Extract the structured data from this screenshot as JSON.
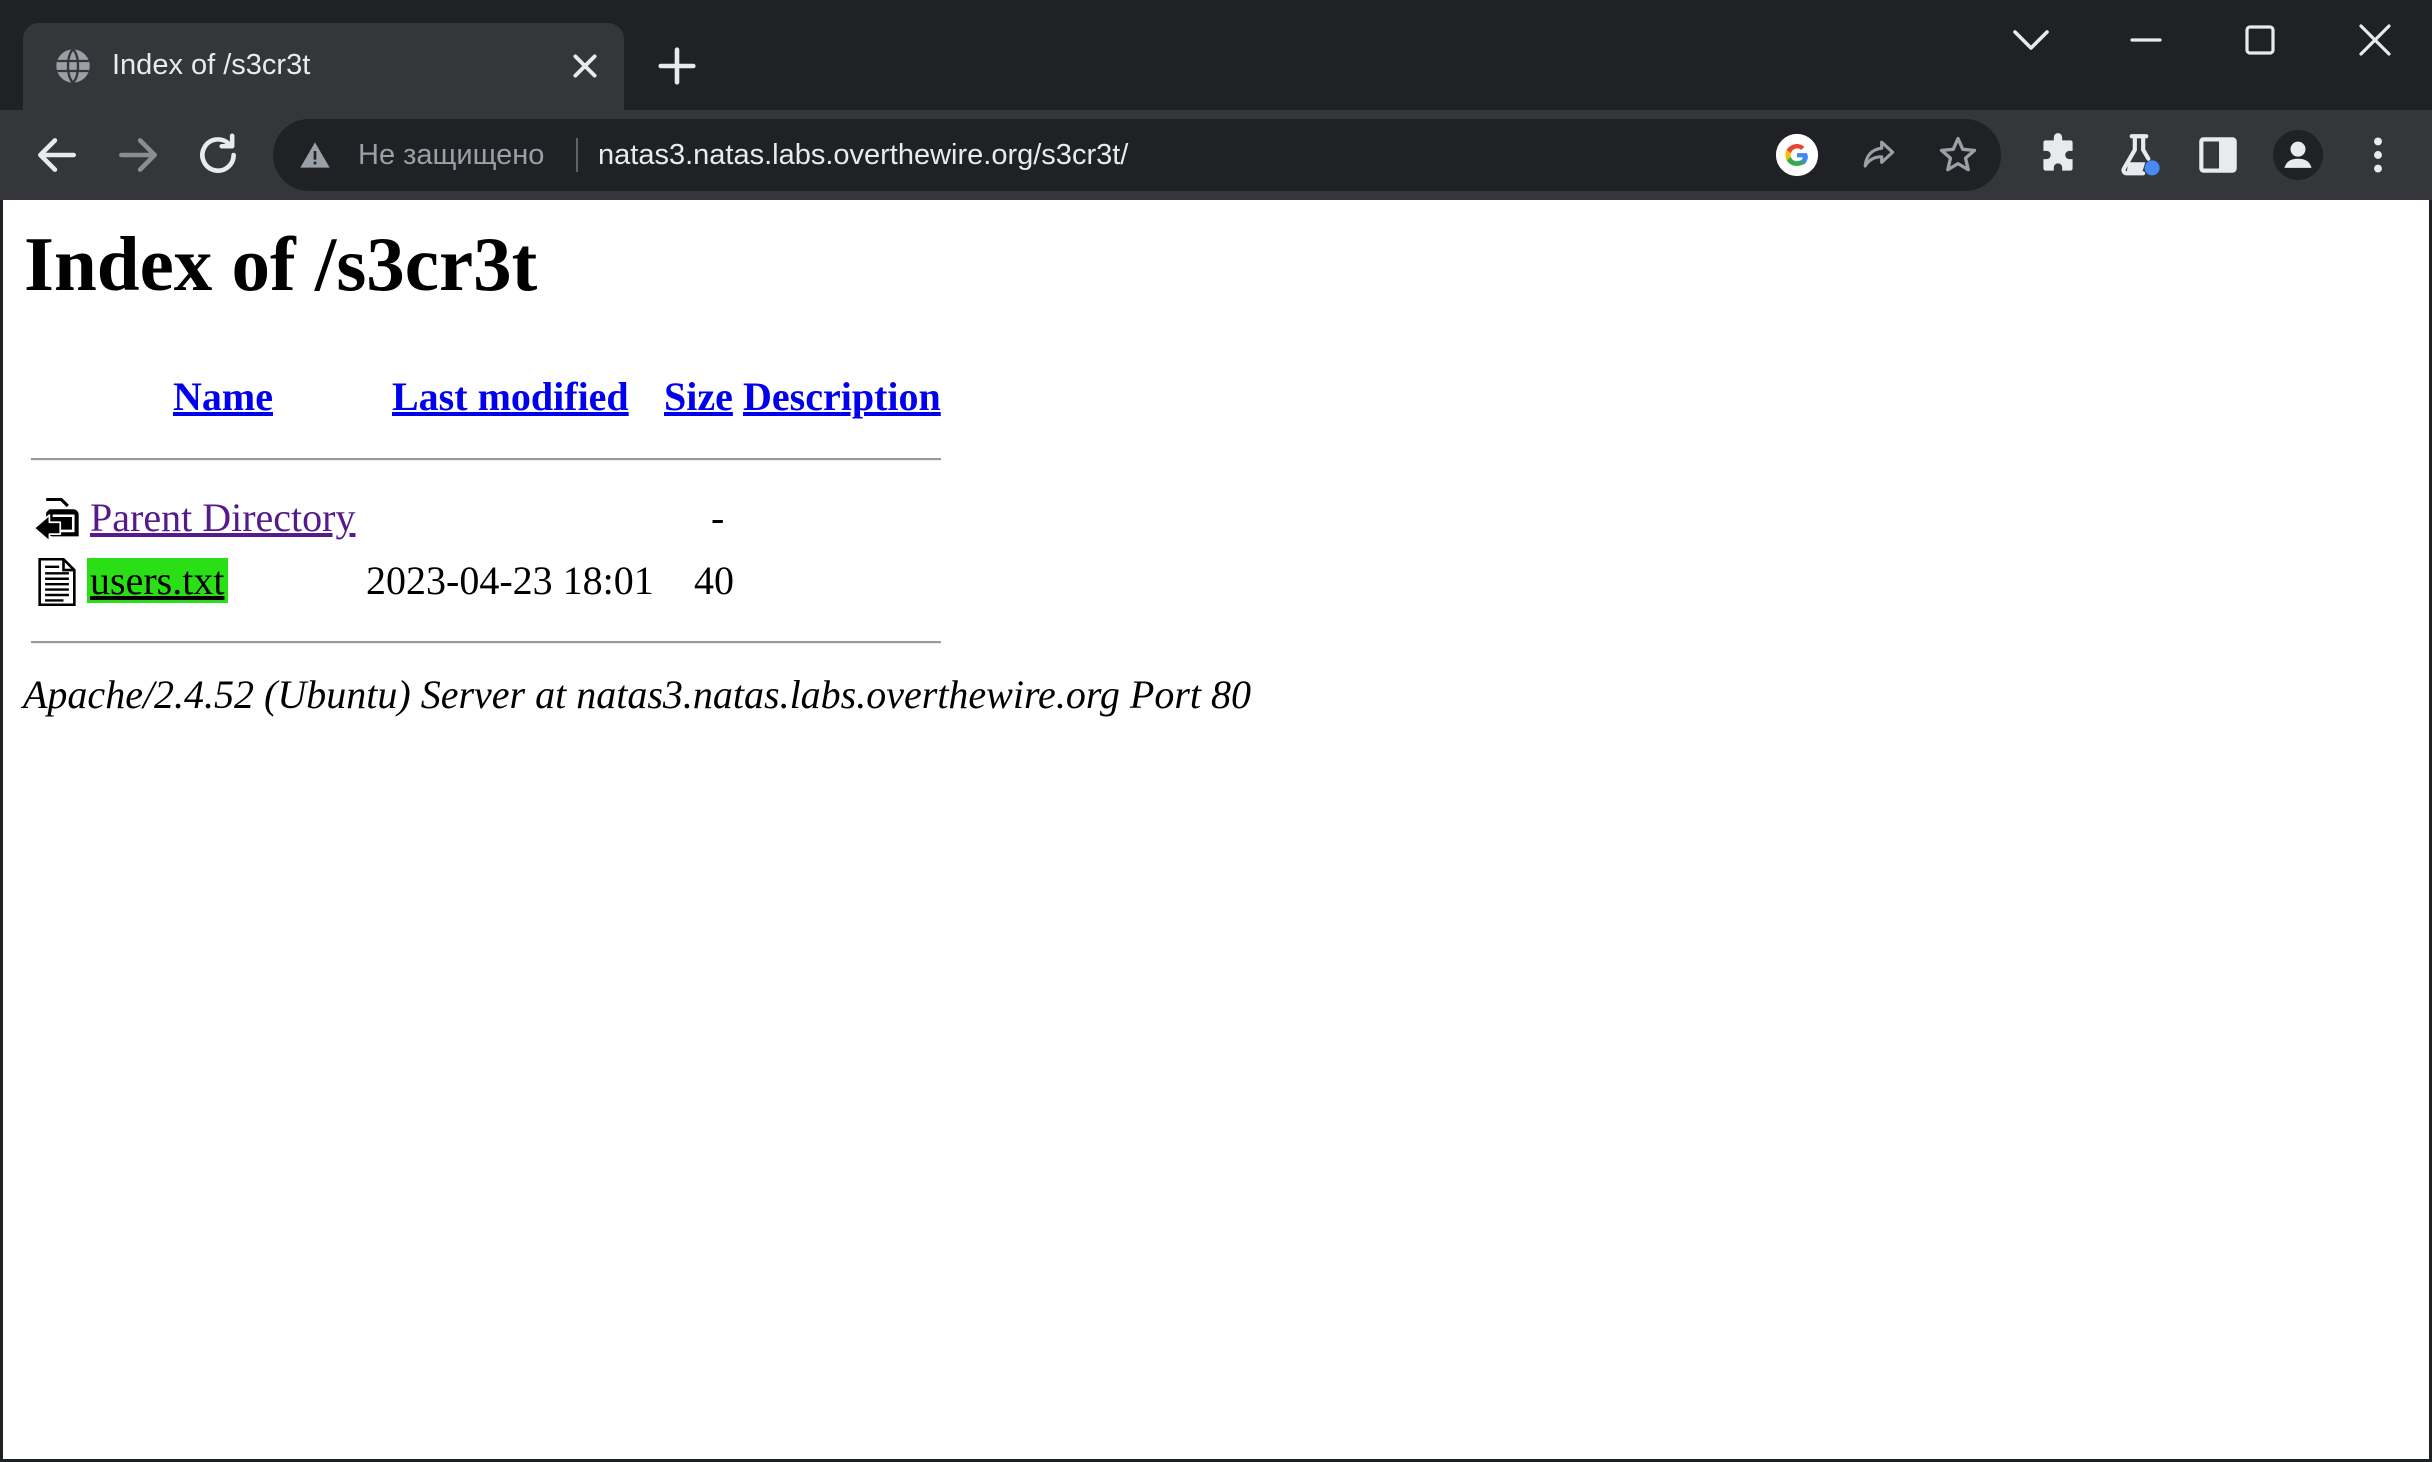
{
  "browser": {
    "tab": {
      "title": "Index of /s3cr3t",
      "favicon": "globe-icon",
      "close_icon": "close-icon"
    },
    "new_tab_icon": "plus-icon",
    "window_controls": [
      "tab-search-chevron-icon",
      "minimize-icon",
      "maximize-icon",
      "close-window-icon"
    ],
    "toolbar": {
      "back_icon": "back-arrow-icon",
      "forward_icon": "forward-arrow-icon",
      "reload_icon": "reload-icon",
      "security_label": "Не защищено",
      "url": "natas3.natas.labs.overthewire.org/s3cr3t/",
      "omnibox_icons": [
        "google-icon",
        "share-icon",
        "star-icon"
      ],
      "right_icons": [
        "extensions-icon",
        "labs-flask-icon",
        "side-panel-icon",
        "profile-avatar-icon",
        "menu-kebab-icon"
      ]
    },
    "colors": {
      "frame": "#202124",
      "toolbar": "#35363a",
      "omnibox": "#202124",
      "link": "#0000ee",
      "visited_link": "#551a8b",
      "highlight": "#2adf16"
    }
  },
  "page": {
    "heading": "Index of /s3cr3t",
    "columns": {
      "name": "Name",
      "last_modified": "Last modified",
      "size": "Size",
      "description": "Description"
    },
    "rows": [
      {
        "icon": "parent-directory-back-icon",
        "name": "Parent Directory",
        "last_modified": "",
        "size": "-",
        "description": ""
      },
      {
        "icon": "text-file-icon",
        "name": "users.txt",
        "last_modified": "2023-04-23 18:01",
        "size": "40",
        "description": ""
      }
    ],
    "footer": "Apache/2.4.52 (Ubuntu) Server at natas3.natas.labs.overthewire.org Port 80"
  }
}
